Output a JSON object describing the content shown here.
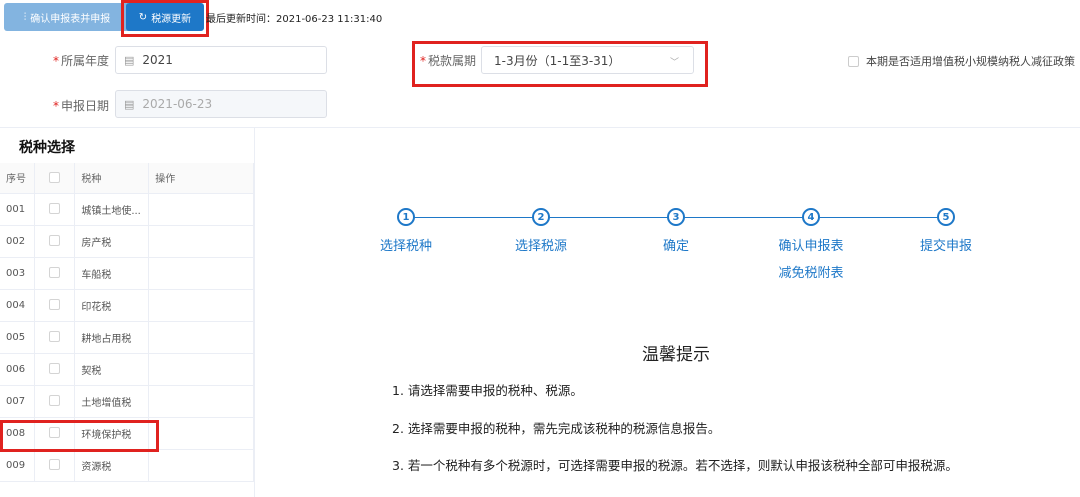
{
  "toolbar": {
    "confirm_button": "确认申报表并申报",
    "update_button": "税源更新",
    "last_update": "最后更新时间：2021-06-23 11:31:40"
  },
  "form": {
    "year_label": "所属年度",
    "year_value": "2021",
    "period_label": "税款属期",
    "period_value": "1-3月份（1-1至3-31）",
    "date_label": "申报日期",
    "date_placeholder": "2021-06-23",
    "policy_label": "本期是否适用增值税小规模纳税人减征政策"
  },
  "tax_panel": {
    "title": "税种选择",
    "columns": [
      "序号",
      "",
      "税种",
      "操作"
    ],
    "rows": [
      {
        "no": "001",
        "name": "城镇土地使..."
      },
      {
        "no": "002",
        "name": "房产税"
      },
      {
        "no": "003",
        "name": "车船税"
      },
      {
        "no": "004",
        "name": "印花税"
      },
      {
        "no": "005",
        "name": "耕地占用税"
      },
      {
        "no": "006",
        "name": "契税"
      },
      {
        "no": "007",
        "name": "土地增值税"
      },
      {
        "no": "008",
        "name": "环境保护税"
      },
      {
        "no": "009",
        "name": "资源税"
      }
    ]
  },
  "steps": [
    {
      "num": "1",
      "label": "选择税种"
    },
    {
      "num": "2",
      "label": "选择税源"
    },
    {
      "num": "3",
      "label": "确定"
    },
    {
      "num": "4",
      "label": "确认申报表"
    },
    {
      "num": "5",
      "label": "提交申报"
    }
  ],
  "step4_sub": "减免税附表",
  "tips": {
    "title": "温馨提示",
    "items": [
      "1. 请选择需要申报的税种、税源。",
      "2. 选择需要申报的税种，需先完成该税种的税源信息报告。",
      "3. 若一个税种有多个税源时，可选择需要申报的税源。若不选择，则默认申报该税种全部可申报税源。"
    ]
  },
  "colors": {
    "primary": "#1e78c8",
    "highlight": "#e0221f"
  }
}
